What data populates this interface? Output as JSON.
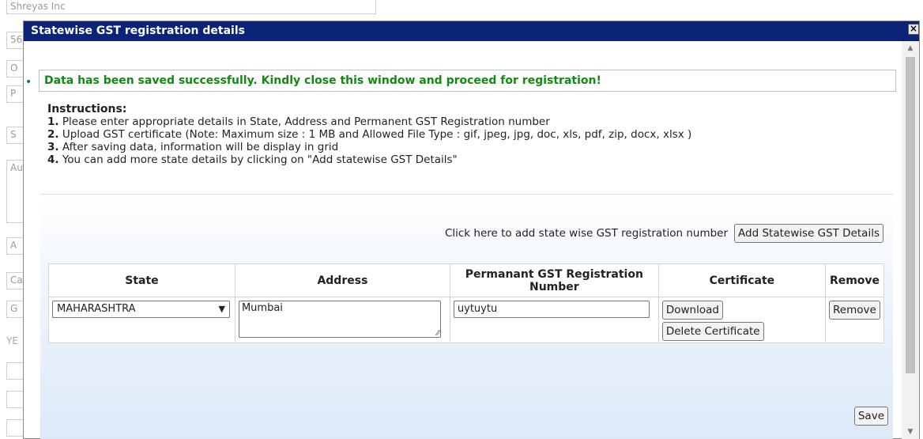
{
  "background": {
    "company_field": "Shreyas Inc",
    "partial_labels": [
      "56",
      "O",
      "P",
      "S",
      "Au",
      "A",
      "Ca",
      "G",
      "YE"
    ]
  },
  "modal": {
    "title": "Statewise GST registration details",
    "close_icon": "close-icon",
    "success_message": "Data has been saved successfully. Kindly close this window and proceed for registration!",
    "instructions": {
      "heading": "Instructions:",
      "items": [
        {
          "num": "1.",
          "text": " Please enter appropriate details in State, Address and Permanent GST Registration number"
        },
        {
          "num": "2.",
          "text": " Upload GST certificate (Note: Maximum size : 1 MB and Allowed File Type : gif, jpeg, jpg, doc, xls, pdf, zip, docx, xlsx )"
        },
        {
          "num": "3.",
          "text": " After saving data, information will be display in grid"
        },
        {
          "num": "4.",
          "text": " You can add more state details by clicking on \"Add statewise GST Details\""
        }
      ]
    },
    "add_prompt": "Click here to add state wise GST registration number",
    "add_button": "Add Statewise GST Details",
    "table": {
      "headers": [
        "State",
        "Address",
        "Permanant GST Registration Number",
        "Certificate",
        "Remove"
      ],
      "rows": [
        {
          "state": "MAHARASHTRA",
          "address": "Mumbai",
          "gst_number": "uytuytu",
          "download_label": "Download",
          "delete_label": "Delete Certificate",
          "remove_label": "Remove"
        }
      ]
    },
    "save_button": "Save"
  }
}
